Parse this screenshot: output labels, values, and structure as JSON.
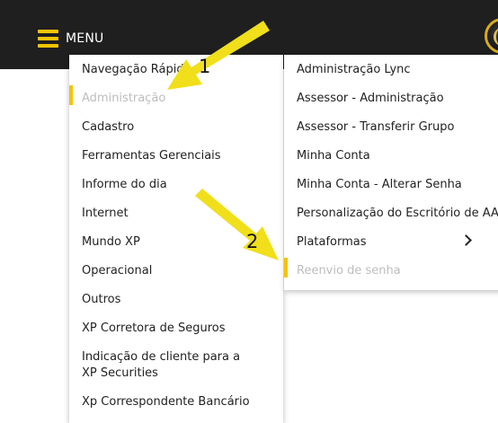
{
  "header": {
    "menu_label": "MENU",
    "menu_icon": "hamburger-icon",
    "logo_icon": "xp-logo-icon",
    "accent_color": "#f5c400",
    "bar_color": "#1f1f1f"
  },
  "left_menu": {
    "items": [
      {
        "label": "Navegação Rápida",
        "state": "normal"
      },
      {
        "label": "Administração",
        "state": "active"
      },
      {
        "label": "Cadastro",
        "state": "normal"
      },
      {
        "label": "Ferramentas Gerenciais",
        "state": "normal"
      },
      {
        "label": "Informe do dia",
        "state": "normal"
      },
      {
        "label": "Internet",
        "state": "normal"
      },
      {
        "label": "Mundo XP",
        "state": "normal"
      },
      {
        "label": "Operacional",
        "state": "normal"
      },
      {
        "label": "Outros",
        "state": "normal"
      },
      {
        "label": "XP Corretora de Seguros",
        "state": "normal"
      },
      {
        "label": "Indicação de cliente para a XP Securities",
        "state": "normal"
      },
      {
        "label": "Xp Correspondente Bancário",
        "state": "normal"
      }
    ]
  },
  "submenu": {
    "items": [
      {
        "label": "Administração Lync",
        "state": "normal"
      },
      {
        "label": "Assessor - Administração",
        "state": "normal"
      },
      {
        "label": "Assessor - Transferir Grupo",
        "state": "normal"
      },
      {
        "label": "Minha Conta",
        "state": "normal"
      },
      {
        "label": "Minha Conta - Alterar Senha",
        "state": "normal"
      },
      {
        "label": "Personalização do Escritório de AAI",
        "state": "normal"
      },
      {
        "label": "Plataformas",
        "state": "normal",
        "has_submenu": true
      },
      {
        "label": "Reenvio de senha",
        "state": "active"
      }
    ]
  },
  "annotations": {
    "arrow_color": "#f0df1a",
    "step1": "1",
    "step2": "2"
  }
}
